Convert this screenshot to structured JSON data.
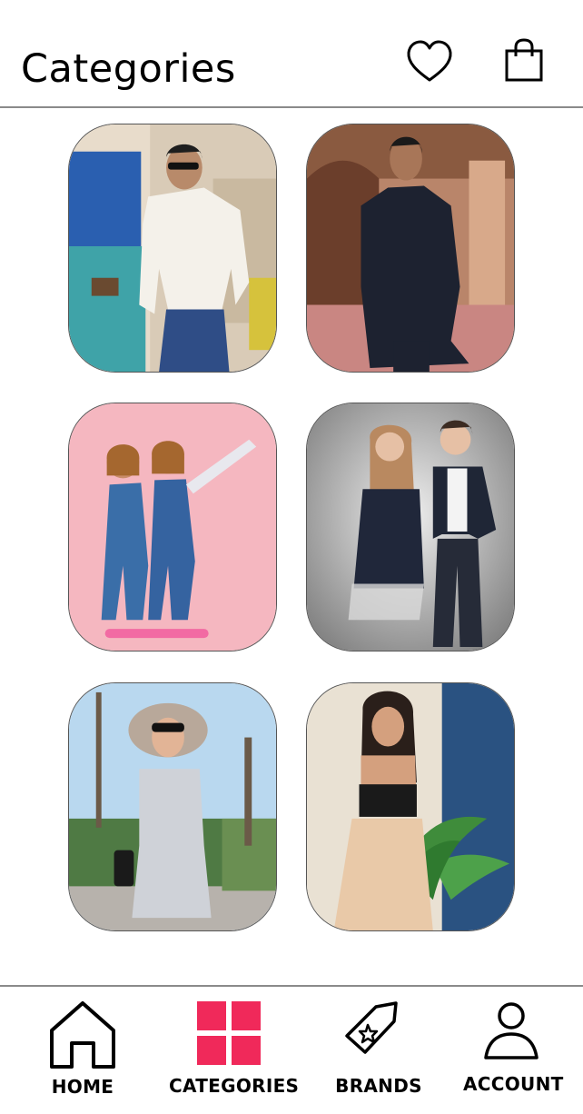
{
  "header": {
    "title": "Categories",
    "wishlist_icon": "heart-icon",
    "bag_icon": "shopping-bag-icon"
  },
  "categories": [
    {
      "id": "men-casual",
      "scene": "man in white shirt and blue trousers"
    },
    {
      "id": "men-ethnic",
      "scene": "man in black kurta"
    },
    {
      "id": "girls",
      "scene": "two girls in denim overalls on pink background"
    },
    {
      "id": "kids",
      "scene": "girl in dress and boy in striped outfit"
    },
    {
      "id": "women-western",
      "scene": "woman in grey dress and sun hat"
    },
    {
      "id": "women-ethnic",
      "scene": "woman in crop top and floral skirt"
    }
  ],
  "bottom_nav": {
    "items": [
      {
        "label": "HOME",
        "icon": "home-icon"
      },
      {
        "label": "CATEGORIES",
        "icon": "grid-icon",
        "active": true
      },
      {
        "label": "BRANDS",
        "icon": "tag-icon"
      },
      {
        "label": "ACCOUNT",
        "icon": "user-icon"
      }
    ],
    "accent_color": "#f0295a"
  }
}
